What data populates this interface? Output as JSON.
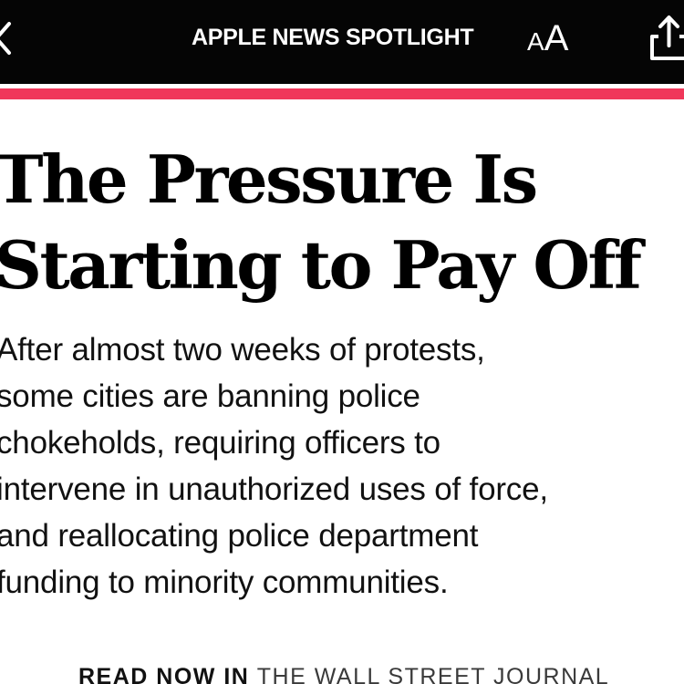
{
  "header": {
    "title": "APPLE NEWS SPOTLIGHT",
    "text_size_small": "A",
    "text_size_large": "A",
    "back_icon": "chevron-left-icon",
    "share_icon": "share-icon"
  },
  "colors": {
    "bar_background": "#050505",
    "accent": "#f0375a",
    "text": "#000000"
  },
  "article": {
    "headline_lines": [
      "The Pressure Is",
      "Starting to Pay Off"
    ],
    "subhead_lines": [
      "After almost two weeks of protests,",
      "some cities are banning police",
      "chokeholds, requiring officers to",
      "intervene in unauthorized uses of force,",
      "and reallocating police department",
      "funding to minority communities."
    ],
    "read_now_prefix": "READ NOW IN ",
    "publisher": "THE WALL STREET JOURNAL"
  }
}
